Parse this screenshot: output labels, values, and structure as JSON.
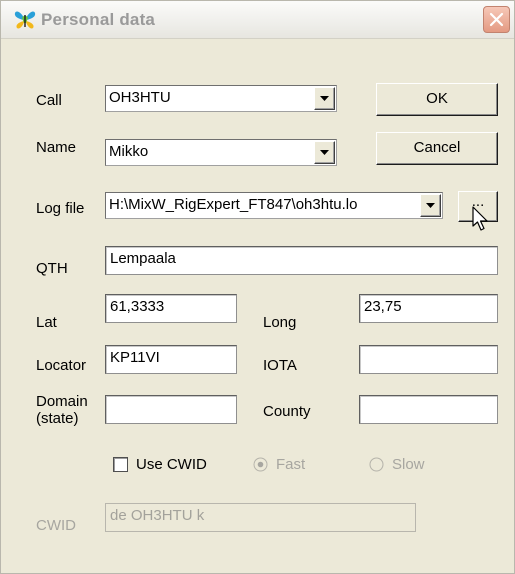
{
  "window": {
    "title": "Personal data"
  },
  "labels": {
    "call": "Call",
    "name": "Name",
    "log_file": "Log file",
    "qth": "QTH",
    "lat": "Lat",
    "long": "Long",
    "locator": "Locator",
    "iota": "IOTA",
    "domain_line1": "Domain",
    "domain_line2": "(state)",
    "county": "County",
    "cwid": "CWID"
  },
  "fields": {
    "call": "OH3HTU",
    "name": "Mikko",
    "log_file": "H:\\MixW_RigExpert_FT847\\oh3htu.lo",
    "qth": "Lempaala",
    "lat": "61,3333",
    "long": "23,75",
    "locator": "KP11VI",
    "iota": "",
    "domain": "",
    "county": "",
    "cwid": "de OH3HTU k"
  },
  "buttons": {
    "ok": "OK",
    "cancel": "Cancel",
    "browse": "..."
  },
  "options": {
    "use_cwid_label": "Use CWID",
    "use_cwid_checked": false,
    "fast_label": "Fast",
    "fast_selected": true,
    "slow_label": "Slow",
    "slow_selected": false
  },
  "icons": {
    "app": "butterfly-icon",
    "close": "close-icon",
    "cursor": "mouse-pointer-icon"
  },
  "colors": {
    "dialog_bg": "#ece9d8",
    "title_text": "#9a9a9a",
    "close_button": "#e49a82",
    "disabled_text": "#a7a6a0"
  }
}
